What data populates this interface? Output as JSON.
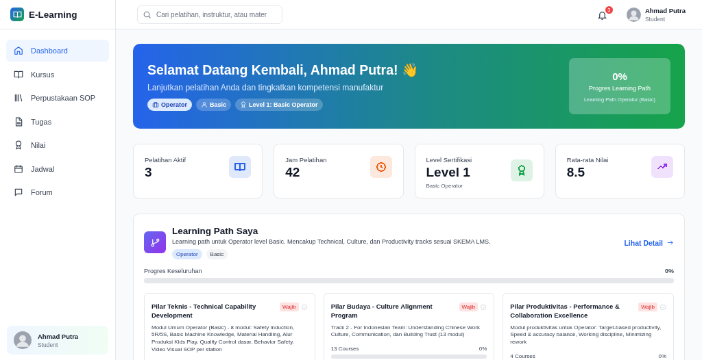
{
  "app": {
    "name": "E-Learning"
  },
  "sidebar": {
    "items": [
      {
        "label": "Dashboard",
        "selected": true
      },
      {
        "label": "Kursus",
        "selected": false
      },
      {
        "label": "Perpustakaan SOP",
        "selected": false
      },
      {
        "label": "Tugas",
        "selected": false
      },
      {
        "label": "Nilai",
        "selected": false
      },
      {
        "label": "Jadwal",
        "selected": false
      },
      {
        "label": "Forum",
        "selected": false
      }
    ],
    "user": {
      "name": "Ahmad Putra",
      "role": "Student"
    }
  },
  "header": {
    "search": {
      "placeholder": "Cari pelatihan, instruktur, atau mater"
    },
    "notifications": "3",
    "user": {
      "name": "Ahmad Putra",
      "role": "Student"
    }
  },
  "banner": {
    "title": "Selamat Datang Kembali, Ahmad Putra! 👋",
    "subtitle": "Lanjutkan pelatihan Anda dan tingkatkan kompetensi manufaktur",
    "tags": [
      "Operator",
      "Basic",
      "Level 1: Basic Operator"
    ],
    "progress": {
      "value": "0%",
      "label": "Progres Learning Path",
      "caption": "Learning Path Operator (Basic)"
    }
  },
  "stats": [
    {
      "label": "Pelatihan Aktif",
      "value": "3",
      "color": "#2563eb"
    },
    {
      "label": "Jam Pelatihan",
      "value": "42",
      "color": "#ea580c"
    },
    {
      "label": "Level Sertifikasi",
      "value": "Level 1",
      "caption": "Basic Operator",
      "color": "#16a34a"
    },
    {
      "label": "Rata-rata Nilai",
      "value": "8.5",
      "color": "#9333ea"
    }
  ],
  "learning_path": {
    "title": "Learning Path Saya",
    "description": "Learning path untuk Operator level Basic. Mencakup Technical, Culture, dan Productivity tracks sesuai SKEMA LMS.",
    "tags": [
      "Operator",
      "Basic"
    ],
    "link": "Lihat Detail",
    "progress_label": "Progres Keseluruhan",
    "progress_value": "0%",
    "level": 0,
    "pillars": [
      {
        "title": "Pilar Teknis - Technical Capability Development",
        "badge": "Wajib",
        "description": "Modul Umum Operator (Basic) - 8 modul: Safety Induction, 5R/5S, Basic Machine Knowledge, Material Handling, Alur Produksi Kids Play, Quality Control dasar, Behavior Safety, Video Visual SOP per station"
      },
      {
        "title": "Pilar Budaya - Culture Alignment Program",
        "badge": "Wajib",
        "description": "Track 2 - For Indonesian Team: Understanding Chinese Work Culture, Communication, dan Building Trust (13 modul)",
        "courses": "13 Courses",
        "percent": "0%",
        "level": 0
      },
      {
        "title": "Pilar Produktivitas - Performance & Collaboration Excellence",
        "badge": "Wajib",
        "description": "Modul produktivitas untuk Operator: Target-based productivity, Speed & accuracy balance, Working discipline, Minimizing rework",
        "courses": "4 Courses",
        "percent": "0%"
      }
    ]
  }
}
